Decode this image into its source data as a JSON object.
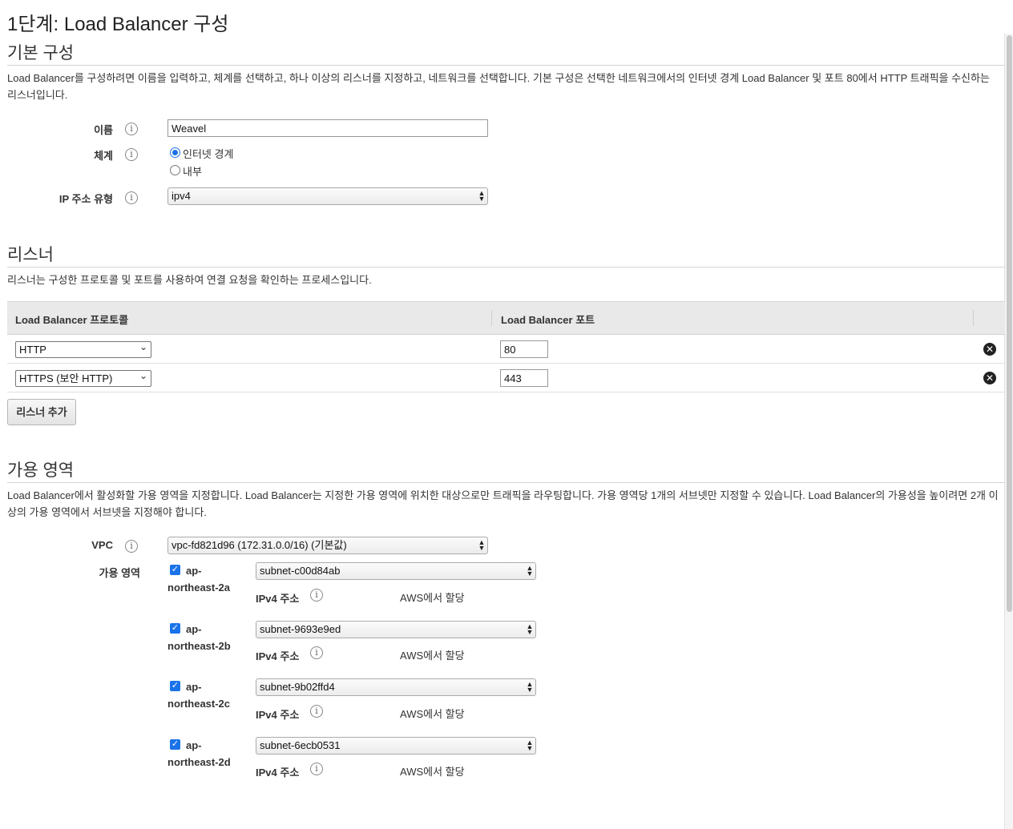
{
  "page_title": "1단계: Load Balancer 구성",
  "basic": {
    "heading": "기본 구성",
    "description": "Load Balancer를 구성하려면 이름을 입력하고, 체계를 선택하고, 하나 이상의 리스너를 지정하고, 네트워크를 선택합니다. 기본 구성은 선택한 네트워크에서의 인터넷 경계 Load Balancer 및 포트 80에서 HTTP 트래픽을 수신하는 리스너입니다.",
    "name_label": "이름",
    "name_value": "Weavel",
    "scheme_label": "체계",
    "scheme_options": [
      "인터넷 경계",
      "내부"
    ],
    "ip_label": "IP 주소 유형",
    "ip_value": "ipv4",
    "info_glyph": "i"
  },
  "listeners": {
    "heading": "리스너",
    "description": "리스너는 구성한 프로토콜 및 포트를 사용하여 연결 요청을 확인하는 프로세스입니다.",
    "col_protocol": "Load Balancer 프로토콜",
    "col_port": "Load Balancer 포트",
    "rows": [
      {
        "protocol": "HTTP",
        "port": "80"
      },
      {
        "protocol": "HTTPS (보안 HTTP)",
        "port": "443"
      }
    ],
    "add_button": "리스너 추가"
  },
  "az": {
    "heading": "가용 영역",
    "description": "Load Balancer에서 활성화할 가용 영역을 지정합니다. Load Balancer는 지정한 가용 영역에 위치한 대상으로만 트래픽을 라우팅합니다. 가용 영역당 1개의 서브넷만 지정할 수 있습니다. Load Balancer의 가용성을 높이려면 2개 이상의 가용 영역에서 서브넷을 지정해야 합니다.",
    "vpc_label": "VPC",
    "vpc_value": "vpc-fd821d96 (172.31.0.0/16) (기본값)",
    "zones_label": "가용 영역",
    "ipv4_label": "IPv4 주소",
    "ipv4_value": "AWS에서 할당",
    "zones": [
      {
        "line1": "ap-",
        "line2": "northeast-2a",
        "subnet": "subnet-c00d84ab"
      },
      {
        "line1": "ap-",
        "line2": "northeast-2b",
        "subnet": "subnet-9693e9ed"
      },
      {
        "line1": "ap-",
        "line2": "northeast-2c",
        "subnet": "subnet-9b02ffd4"
      },
      {
        "line1": "ap-",
        "line2": "northeast-2d",
        "subnet": "subnet-6ecb0531"
      }
    ]
  },
  "icons": {
    "remove": "close-circle-icon",
    "info": "info-icon",
    "check": "checkmark-icon"
  },
  "glyphs": {
    "check": "✓",
    "remove": "✕",
    "select_arrows": "▲▼",
    "chevron": "⌄"
  },
  "colors": {
    "accent": "#1a73e8",
    "header_bg": "#e9e9e9",
    "rule": "#d5d5d5"
  }
}
